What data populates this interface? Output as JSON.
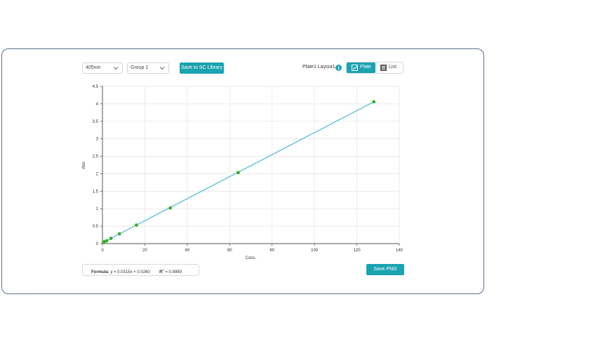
{
  "controls": {
    "wavelength_select": "405nm",
    "group_select": "Group 1",
    "save_sc_library_label": "Save to SC Library",
    "layout_label": "Plate1 Layout1",
    "view_toggle": {
      "plate_label": "Plate",
      "list_label": "List",
      "selected": "Plate"
    }
  },
  "footer": {
    "formula_label": "Formula:",
    "formula_value": "y = 0.0315x + 0.0260",
    "r2_label": "R",
    "r2_sup": "2",
    "r2_value": "= 0.9999",
    "save_png_label": "Save PNG"
  },
  "icons": [
    "chevron-down-icon",
    "info-icon",
    "chart-icon",
    "list-icon"
  ],
  "colors": {
    "accent": "#1aa3b0",
    "line": "#5bbcd6",
    "points": "#3aad2a"
  },
  "chart_data": {
    "type": "scatter",
    "xlabel": "Conc.",
    "ylabel": "Abs.",
    "xlim": [
      0,
      140
    ],
    "ylim": [
      0,
      4.5
    ],
    "xticks": [
      0,
      20,
      40,
      60,
      80,
      100,
      120,
      140
    ],
    "yticks": [
      0,
      0.5,
      1,
      1.5,
      2,
      2.5,
      3,
      3.5,
      4,
      4.5
    ],
    "grid": true,
    "points": [
      {
        "x": 0.5,
        "y": 0.04
      },
      {
        "x": 1,
        "y": 0.06
      },
      {
        "x": 2,
        "y": 0.08
      },
      {
        "x": 4,
        "y": 0.15
      },
      {
        "x": 8,
        "y": 0.28
      },
      {
        "x": 16,
        "y": 0.53
      },
      {
        "x": 32,
        "y": 1.02
      },
      {
        "x": 64,
        "y": 2.03
      },
      {
        "x": 128,
        "y": 4.06
      }
    ],
    "fit_line": {
      "slope": 0.0315,
      "intercept": 0.026,
      "x_range": [
        0,
        128
      ]
    }
  }
}
